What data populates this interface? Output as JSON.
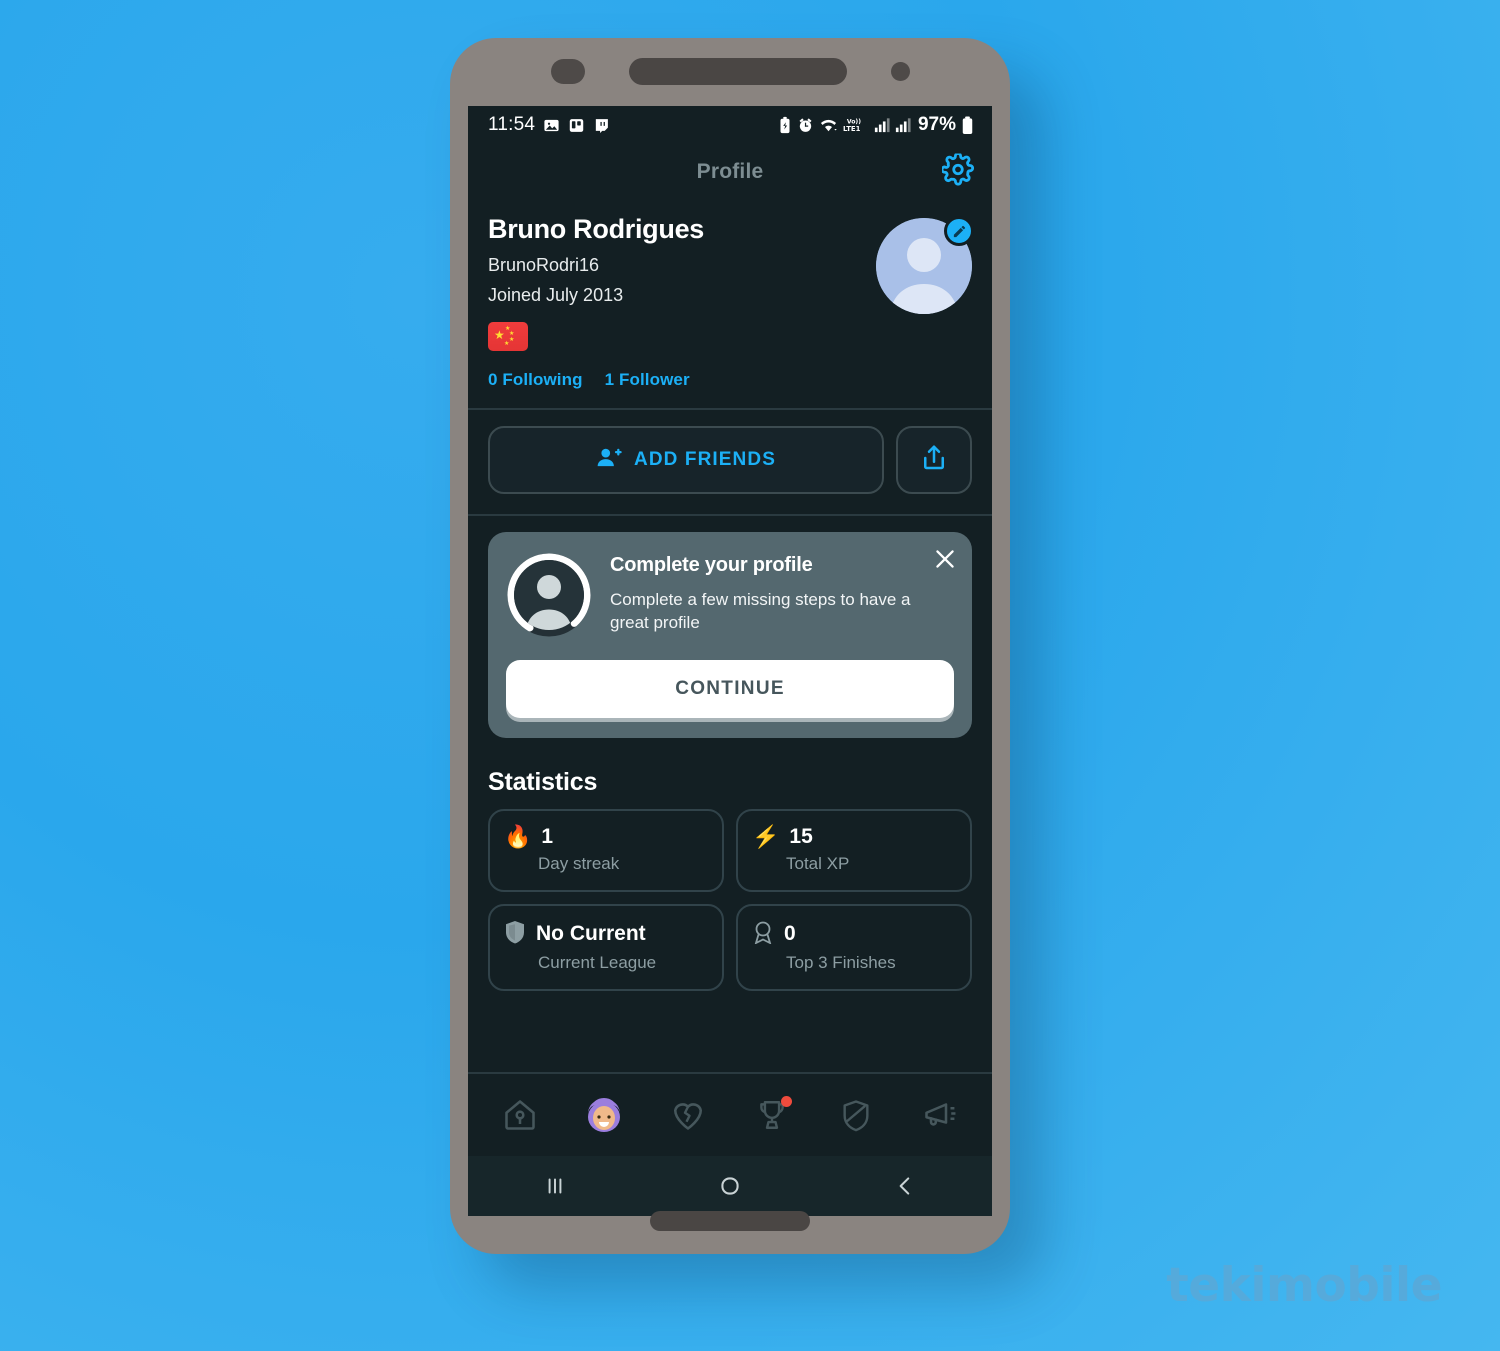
{
  "background": {
    "color": "#2aa7ec"
  },
  "watermark": {
    "text": "tekimobile",
    "color": "#5aa9d8"
  },
  "status_bar": {
    "time": "11:54",
    "left_icons": [
      "gallery-icon",
      "trello-icon",
      "twitch-icon"
    ],
    "right_icons": [
      "battery-saver-icon",
      "alarm-icon",
      "wifi-icon",
      "volte1-icon",
      "signal-1-icon",
      "signal-2-icon"
    ],
    "volte_label": "Vo)) LTE1",
    "battery_percent": "97%"
  },
  "app_bar": {
    "title": "Profile",
    "settings_icon": "gear-icon",
    "accent": "#1cb0f6"
  },
  "profile": {
    "name": "Bruno Rodrigues",
    "username": "BrunoRodri16",
    "joined": "Joined July 2013",
    "flag": "china-flag",
    "following": "0 Following",
    "followers": "1 Follower",
    "avatar": "default-person-avatar",
    "edit_badge": "pencil-icon"
  },
  "actions": {
    "add_friends_label": "ADD FRIENDS",
    "add_friends_icon": "person-add-icon",
    "share_icon": "share-icon"
  },
  "complete_profile_card": {
    "avatar_icon": "person-ring-avatar",
    "progress_percent": 80,
    "title": "Complete your profile",
    "subtitle": "Complete a few missing steps to have a great profile",
    "continue_label": "CONTINUE",
    "close_icon": "close-icon",
    "card_color": "#54686f"
  },
  "statistics": {
    "heading": "Statistics",
    "cards": [
      {
        "icon": "fire-emoji",
        "value": "1",
        "label": "Day streak"
      },
      {
        "icon": "lightning-emoji",
        "value": "15",
        "label": "Total XP"
      },
      {
        "icon": "shield-icon",
        "value": "No Current",
        "label": "Current League"
      },
      {
        "icon": "medal-icon",
        "value": "0",
        "label": "Top 3 Finishes"
      }
    ]
  },
  "bottom_nav": {
    "items": [
      {
        "icon": "home-icon",
        "selected": false,
        "badge": false
      },
      {
        "icon": "profile-avatar-icon",
        "selected": true,
        "badge": false
      },
      {
        "icon": "broken-heart-icon",
        "selected": false,
        "badge": false
      },
      {
        "icon": "trophy-icon",
        "selected": false,
        "badge": true
      },
      {
        "icon": "shield-icon",
        "selected": false,
        "badge": false
      },
      {
        "icon": "megaphone-icon",
        "selected": false,
        "badge": false
      }
    ]
  },
  "android_nav": {
    "recents_icon": "recents-icon",
    "home_icon": "home-circle-icon",
    "back_icon": "back-chevron-icon"
  }
}
